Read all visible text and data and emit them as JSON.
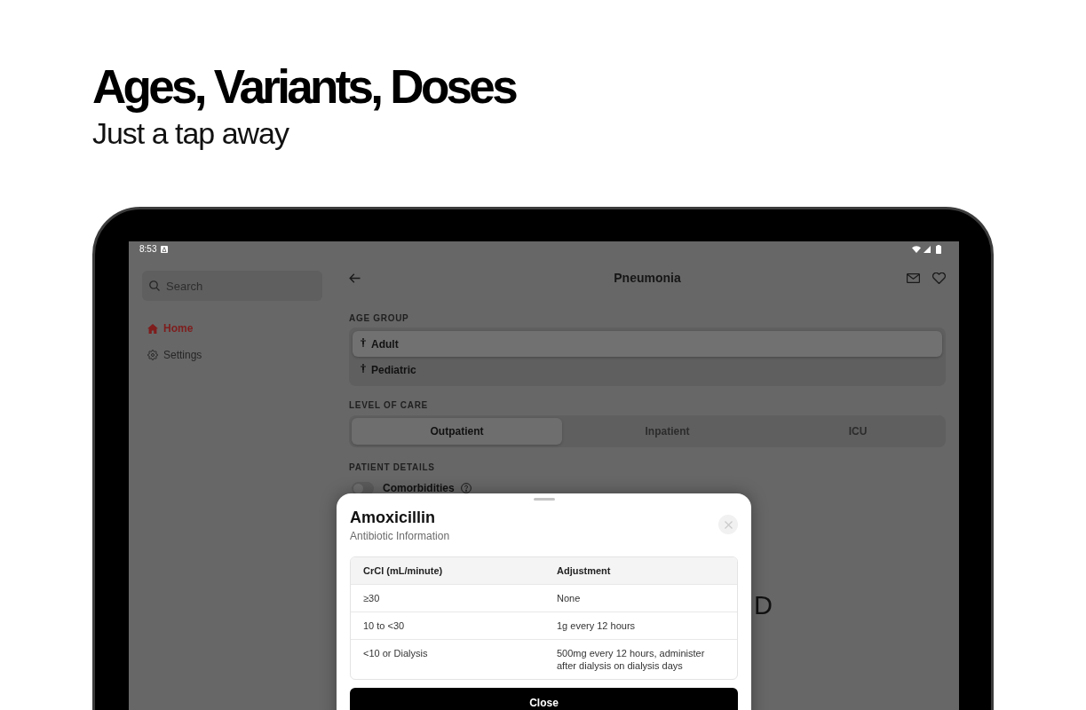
{
  "headline": {
    "title": "Ages, Variants, Doses",
    "subtitle": "Just a tap away"
  },
  "status_bar": {
    "time": "8:53"
  },
  "sidebar": {
    "search": {
      "placeholder": "Search"
    },
    "items": [
      {
        "label": "Home",
        "selected": true,
        "kind": "home"
      },
      {
        "label": "Settings",
        "selected": false,
        "kind": "settings"
      }
    ]
  },
  "header": {
    "title": "Pneumonia"
  },
  "age_group": {
    "label": "AGE GROUP",
    "options": [
      {
        "label": "Adult",
        "selected": true
      },
      {
        "label": "Pediatric",
        "selected": false
      }
    ]
  },
  "level_of_care": {
    "label": "LEVEL OF CARE",
    "options": [
      {
        "label": "Outpatient",
        "selected": true
      },
      {
        "label": "Inpatient",
        "selected": false
      },
      {
        "label": "ICU",
        "selected": false
      }
    ]
  },
  "patient_details": {
    "label": "PATIENT DETAILS",
    "toggles": [
      {
        "label": "Comorbidities",
        "on": false
      }
    ]
  },
  "obscured_text": "D",
  "modal": {
    "title": "Amoxicillin",
    "subtitle": "Antibiotic Information",
    "table": {
      "columns": [
        "CrCl (mL/minute)",
        "Adjustment"
      ],
      "rows": [
        [
          "≥30",
          "None"
        ],
        [
          "10 to <30",
          "1g every 12 hours"
        ],
        [
          "<10 or Dialysis",
          "500mg every 12 hours, administer after dialysis on dialysis days"
        ]
      ]
    },
    "button": "Close"
  }
}
